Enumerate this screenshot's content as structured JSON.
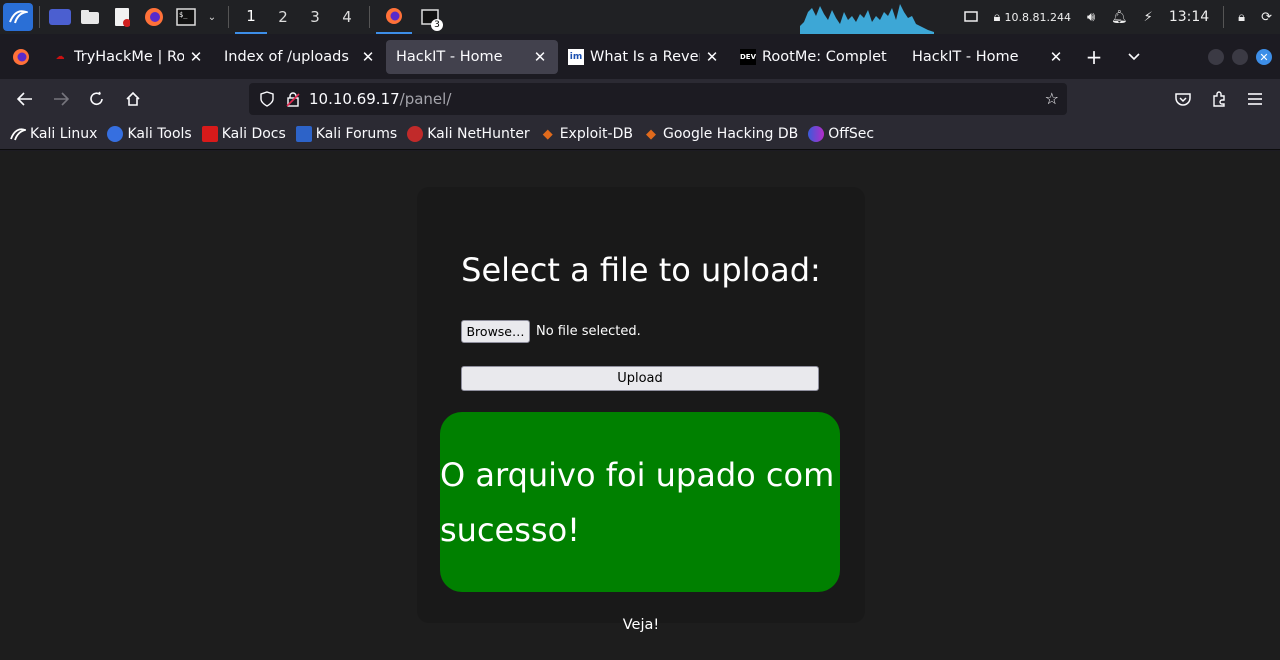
{
  "system_panel": {
    "workspaces": [
      "1",
      "2",
      "3",
      "4"
    ],
    "active_workspace": "1",
    "task_badge": "3",
    "ip": "10.8.81.244",
    "clock": "13:14"
  },
  "tabs": [
    {
      "label": "TryHackMe | Root",
      "icon": "tryhackme-icon",
      "active": false
    },
    {
      "label": "Index of /uploads",
      "icon": "none",
      "active": false
    },
    {
      "label": "HackIT - Home",
      "icon": "none",
      "active": true
    },
    {
      "label": "What Is a Reverse",
      "icon": "im-icon",
      "active": false
    },
    {
      "label": "RootMe: Complet",
      "icon": "dev-icon",
      "active": false
    },
    {
      "label": "HackIT - Home",
      "icon": "none",
      "active": false
    }
  ],
  "tab_icons": {
    "im": "im",
    "dev": "DEV"
  },
  "url": {
    "host": "10.10.69.17",
    "path": "/panel/"
  },
  "bookmarks": [
    {
      "label": "Kali Linux",
      "icon": "kali-icon"
    },
    {
      "label": "Kali Tools",
      "icon": "kali-tools-icon"
    },
    {
      "label": "Kali Docs",
      "icon": "kali-docs-icon"
    },
    {
      "label": "Kali Forums",
      "icon": "kali-forums-icon"
    },
    {
      "label": "Kali NetHunter",
      "icon": "nethunter-icon"
    },
    {
      "label": "Exploit-DB",
      "icon": "exploit-db-icon"
    },
    {
      "label": "Google Hacking DB",
      "icon": "ghdb-icon"
    },
    {
      "label": "OffSec",
      "icon": "offsec-icon"
    }
  ],
  "page": {
    "title": "Select a file to upload:",
    "browse_label": "Browse…",
    "file_status": "No file selected.",
    "upload_label": "Upload",
    "success_message": "O arquivo foi upado com sucesso!",
    "veja_link": "Veja!"
  },
  "colors": {
    "accent": "#3d8ee8",
    "success_bg": "#008000",
    "page_bg": "#1d1d1d",
    "card_bg": "#191919"
  }
}
